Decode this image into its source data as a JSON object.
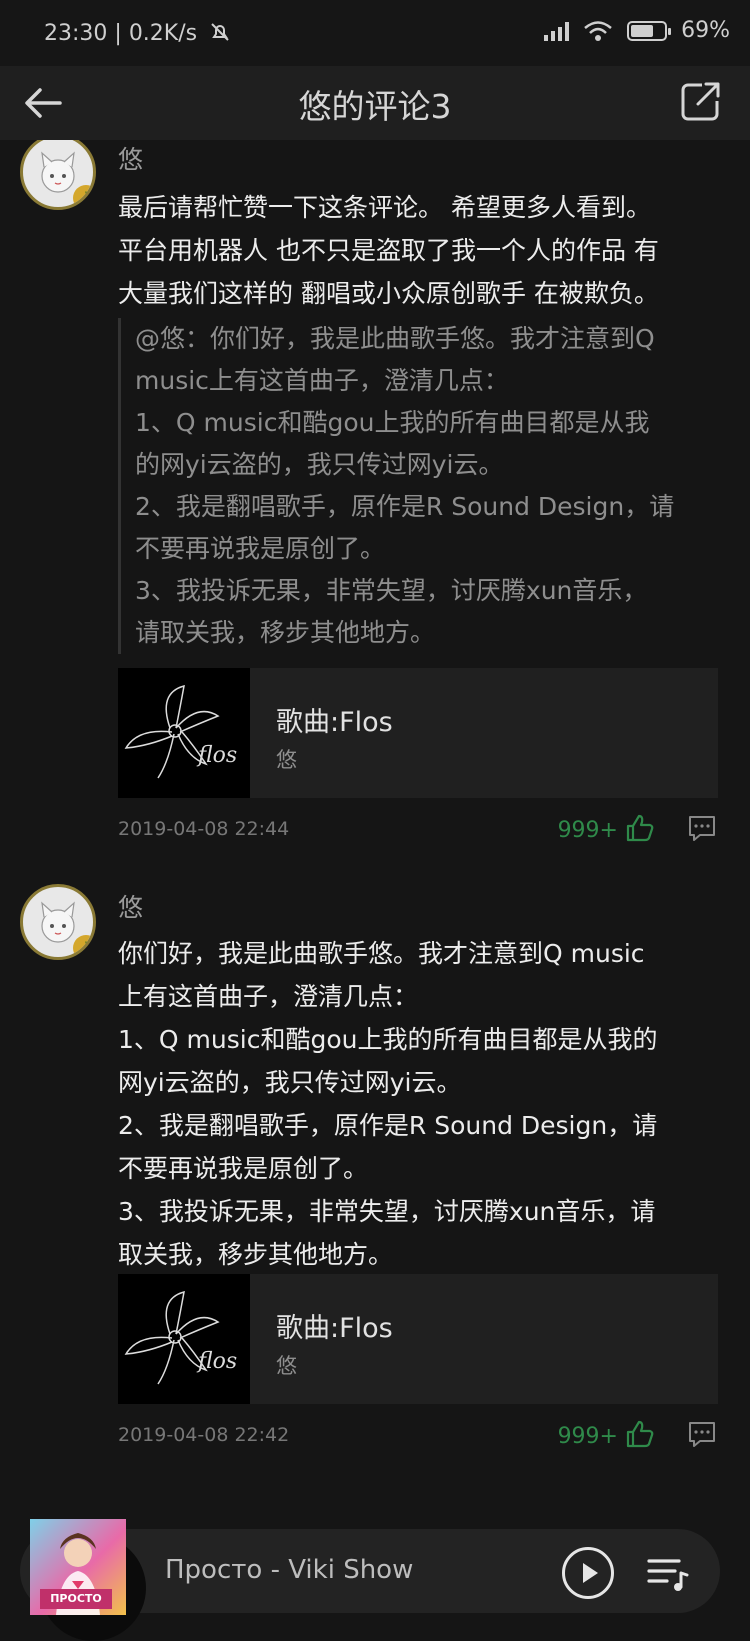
{
  "status_bar": {
    "time": "23:30",
    "speed": "0.2K/s",
    "battery_text": "69%",
    "battery_level": 0.69,
    "icons": [
      "mute-bell-icon",
      "hd-signal-icon",
      "wifi-icon",
      "battery-icon"
    ]
  },
  "nav": {
    "title": "悠的评论3",
    "back_icon": "back-arrow-icon",
    "share_icon": "share-icon"
  },
  "comments": [
    {
      "username": "悠",
      "text": "最后请帮忙赞一下这条评论。 希望更多人看到。\n平台用机器人 也不只是盗取了我一个人的作品 有\n大量我们这样的 翻唱或小众原创歌手 在被欺负。",
      "quote": "@悠：你们好，我是此曲歌手悠。我才注意到Q\nmusic上有这首曲子，澄清几点：\n1、Q music和酷gou上我的所有曲目都是从我\n的网yi云盗的，我只传过网yi云。\n2、我是翻唱歌手，原作是R Sound Design，请\n不要再说我是原创了。\n3、我投诉无果，非常失望，讨厌腾xun音乐，\n请取关我，移步其他地方。",
      "song_title": "歌曲:Flos",
      "song_artist": "悠",
      "cover_text": "flos",
      "timestamp": "2019-04-08 22:44",
      "likes": "999+"
    },
    {
      "username": "悠",
      "text": "你们好，我是此曲歌手悠。我才注意到Q music\n上有这首曲子，澄清几点：\n1、Q music和酷gou上我的所有曲目都是从我的\n网yi云盗的，我只传过网yi云。\n2、我是翻唱歌手，原作是R Sound Design，请\n不要再说我是原创了。\n3、我投诉无果，非常失望，讨厌腾xun音乐，请\n取关我，移步其他地方。",
      "song_title": "歌曲:Flos",
      "song_artist": "悠",
      "cover_text": "flos",
      "timestamp": "2019-04-08 22:42",
      "likes": "999+"
    }
  ],
  "player": {
    "track": "Просто - Viki Show",
    "art_badge": "ПРОСТО"
  },
  "colors": {
    "background": "#151515",
    "like_green": "#2f8a4a",
    "text": "#ececec"
  }
}
